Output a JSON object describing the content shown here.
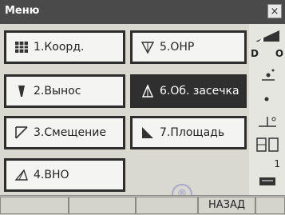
{
  "window": {
    "title": "Меню",
    "close": "×"
  },
  "menu": {
    "items": [
      {
        "label": "1.Коорд.",
        "icon": "grid-icon",
        "selected": false
      },
      {
        "label": "2.Вынос",
        "icon": "stakeout-icon",
        "selected": false
      },
      {
        "label": "3.Смещение",
        "icon": "offset-icon",
        "selected": false
      },
      {
        "label": "4.ВНО",
        "icon": "triangle-icon",
        "selected": false
      },
      {
        "label": "5.ОНР",
        "icon": "target-icon",
        "selected": false
      },
      {
        "label": "6.Об. засечка",
        "icon": "resection-icon",
        "selected": true
      },
      {
        "label": "7.Площадь",
        "icon": "area-icon",
        "selected": false
      }
    ]
  },
  "status": {
    "d_label": "D",
    "o_label": "O",
    "num": "1"
  },
  "softkeys": [
    "",
    "",
    "",
    "НАЗАД"
  ],
  "watermark": {
    "symbol": "®"
  }
}
